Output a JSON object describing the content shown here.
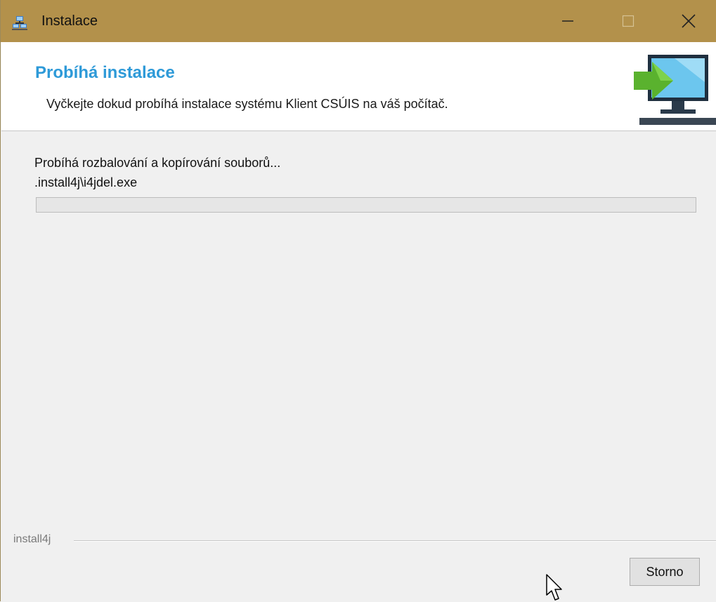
{
  "window": {
    "title": "Instalace",
    "icon": "installer-icon",
    "controls": [
      "minimize-icon",
      "maximize-icon",
      "close-icon"
    ]
  },
  "header": {
    "title": "Probíhá instalace",
    "subtitle": "Vyčkejte dokud probíhá instalace systému Klient CSÚIS na váš počítač.",
    "icon": "computer-arrow-icon"
  },
  "content": {
    "status": "Probíhá rozbalování a kopírování souborů...",
    "current_file": ".install4j\\i4jdel.exe",
    "progress": 0
  },
  "footer": {
    "brand": "install4j",
    "cancel_label": "Storno"
  },
  "colors": {
    "titlebar": "#b3914b",
    "header_title": "#2e9ad8",
    "background": "#f0f0f0"
  }
}
